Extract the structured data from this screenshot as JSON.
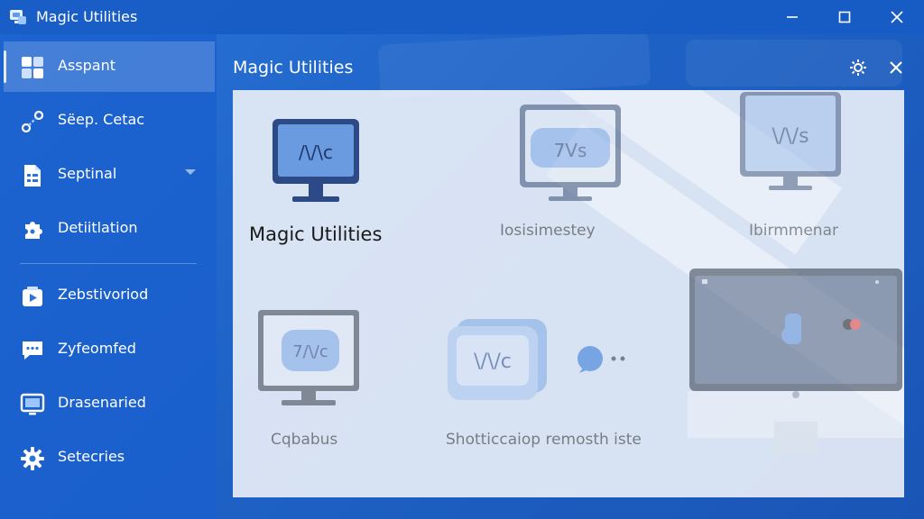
{
  "window": {
    "title": "Magic Utilities",
    "controls": [
      "minimize",
      "maximize",
      "close"
    ]
  },
  "sidebar": {
    "items": [
      {
        "label": "Asspant",
        "icon": "grid-icon",
        "active": true
      },
      {
        "label": "Sëep. Cetac",
        "icon": "link-icon",
        "active": false
      },
      {
        "label": "Septinal",
        "icon": "document-icon",
        "active": false,
        "has_chevron": true
      },
      {
        "label": "Detiitlation",
        "icon": "puzzle-icon",
        "active": false
      },
      {
        "label": "Zebstivoriod",
        "icon": "play-icon",
        "active": false
      },
      {
        "label": "Zyfeomfed",
        "icon": "chat-icon",
        "active": false
      },
      {
        "label": "Drasenaried",
        "icon": "monitor-icon",
        "active": false
      },
      {
        "label": "Setecries",
        "icon": "gear-icon",
        "active": false
      }
    ]
  },
  "panel": {
    "title": "Magic Utilities",
    "tiles": [
      {
        "label": "Magic Utilities",
        "screen_text": "/\\/\\c"
      },
      {
        "label": "Iosisimestey",
        "screen_text": "7Vs"
      },
      {
        "label": "Ibirmmenar",
        "screen_text": "\\/\\/s"
      },
      {
        "label": "Cqbabus",
        "screen_text": "7/\\/c"
      },
      {
        "label": "Shotticcaiop remosth iste",
        "screen_text": "\\/\\/c"
      },
      {
        "label": "",
        "screen_text": ""
      }
    ]
  },
  "colors": {
    "accent": "#1e62c6",
    "sidebar": "#195fcd",
    "content_bg": "#eef2f8",
    "monitor_frame": "#2b4a86",
    "monitor_screen": "#6a9be0"
  }
}
